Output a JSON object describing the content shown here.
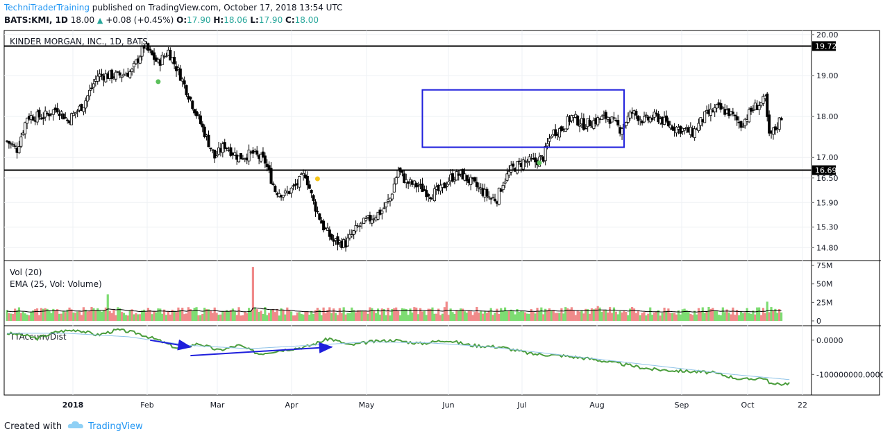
{
  "header": {
    "author": "TechniTraderTraining",
    "published": "published on TradingView.com, October 17, 2018 13:54 UTC",
    "symbol": "BATS:KMI, 1D",
    "last": "18.00",
    "change": "+0.08 (+0.45%)",
    "o_label": "O:",
    "o_value": "17.90",
    "h_label": "H:",
    "h_value": "18.06",
    "l_label": "L:",
    "l_value": "17.90",
    "c_label": "C:",
    "c_value": "18.00"
  },
  "footer": {
    "created_with": "Created with",
    "brand": "TradingView"
  },
  "colors": {
    "up": "#26c749",
    "down": "#000000",
    "vol_up": "#7ddc72",
    "vol_down": "#f08a8a",
    "box": "#1f1fdc",
    "arrow": "#1f1fdc",
    "osc": "#4a9d3c",
    "osc_ma": "#8fc3e8",
    "dot_green": "#5cc05c",
    "dot_yellow": "#f5c518"
  },
  "chart_data": [
    {
      "type": "candlestick",
      "title": "KINDER MORGAN, INC., 1D, BATS",
      "y_ticks": [
        20.0,
        19.0,
        18.0,
        17.0,
        16.5,
        15.9,
        15.3,
        14.8
      ],
      "y_tick_labels": [
        "20.00",
        "19.00",
        "18.00",
        "17.00",
        "16.50",
        "15.90",
        "15.30",
        "14.80"
      ],
      "ylim": [
        14.5,
        20.1
      ],
      "x_tick_labels": [
        "2018",
        "Feb",
        "Mar",
        "Apr",
        "May",
        "Jun",
        "Jul",
        "Aug",
        "Sep",
        "Oct",
        "22"
      ],
      "horizontal_lines": [
        {
          "price": 19.72,
          "label": "19.72"
        },
        {
          "price": 16.69,
          "label": "16.69"
        }
      ],
      "range_box": {
        "start_day": 206,
        "end_day": 306,
        "top": 18.65,
        "bottom": 17.25
      },
      "close_path": [
        [
          0,
          17.4
        ],
        [
          5,
          17.2
        ],
        [
          10,
          18.0
        ],
        [
          18,
          18.0
        ],
        [
          25,
          18.2
        ],
        [
          30,
          17.9
        ],
        [
          38,
          18.3
        ],
        [
          45,
          19.0
        ],
        [
          55,
          19.0
        ],
        [
          62,
          19.1
        ],
        [
          68,
          19.72
        ],
        [
          75,
          19.3
        ],
        [
          80,
          19.6
        ],
        [
          86,
          19.0
        ],
        [
          92,
          18.3
        ],
        [
          98,
          17.6
        ],
        [
          103,
          17.0
        ],
        [
          108,
          17.3
        ],
        [
          115,
          17.0
        ],
        [
          122,
          17.1
        ],
        [
          128,
          16.9
        ],
        [
          133,
          16.2
        ],
        [
          138,
          16.1
        ],
        [
          143,
          16.3
        ],
        [
          148,
          16.6
        ],
        [
          152,
          15.9
        ],
        [
          157,
          15.3
        ],
        [
          162,
          14.95
        ],
        [
          168,
          14.9
        ],
        [
          174,
          15.3
        ],
        [
          180,
          15.5
        ],
        [
          186,
          15.7
        ],
        [
          190,
          16.0
        ],
        [
          194,
          16.7
        ],
        [
          198,
          16.4
        ],
        [
          204,
          16.3
        ],
        [
          210,
          16.1
        ],
        [
          215,
          16.2
        ],
        [
          220,
          16.5
        ],
        [
          225,
          16.6
        ],
        [
          230,
          16.4
        ],
        [
          235,
          16.2
        ],
        [
          240,
          16.0
        ],
        [
          243,
          16.0
        ],
        [
          246,
          16.4
        ],
        [
          250,
          16.7
        ],
        [
          256,
          16.9
        ],
        [
          262,
          16.9
        ],
        [
          266,
          17.0
        ],
        [
          270,
          17.6
        ],
        [
          275,
          17.7
        ],
        [
          280,
          18.0
        ],
        [
          286,
          17.8
        ],
        [
          292,
          17.9
        ],
        [
          298,
          18.0
        ],
        [
          304,
          17.7
        ],
        [
          310,
          18.1
        ],
        [
          316,
          17.9
        ],
        [
          322,
          18.0
        ],
        [
          328,
          17.8
        ],
        [
          334,
          17.7
        ],
        [
          340,
          17.6
        ],
        [
          346,
          18.0
        ],
        [
          352,
          18.2
        ],
        [
          358,
          18.1
        ],
        [
          364,
          17.8
        ],
        [
          370,
          18.2
        ],
        [
          376,
          18.4
        ],
        [
          378,
          17.5
        ],
        [
          381,
          17.7
        ],
        [
          384,
          18.0
        ]
      ],
      "dots": [
        {
          "day": 75,
          "price": 18.85,
          "color": "green"
        },
        {
          "day": 154,
          "price": 16.48,
          "color": "yellow"
        },
        {
          "day": 264,
          "price": 16.87,
          "color": "green"
        }
      ]
    },
    {
      "type": "bar",
      "title": "Vol (20)",
      "subtitle": "EMA (25, Vol: Volume)",
      "y_ticks": [
        75,
        50,
        25,
        0
      ],
      "y_tick_labels": [
        "75M",
        "50M",
        "25M",
        "0"
      ],
      "unit": "M",
      "ylim": [
        0,
        75
      ],
      "typical_volume": 13,
      "spikes": [
        {
          "day": 50,
          "value": 36
        },
        {
          "day": 122,
          "value": 73
        },
        {
          "day": 218,
          "value": 26
        },
        {
          "day": 293,
          "value": 20
        },
        {
          "day": 377,
          "value": 26
        }
      ]
    },
    {
      "type": "line",
      "title": "TTAccum/Dist",
      "y_ticks": [
        0,
        -100000000
      ],
      "y_tick_labels": [
        "0.0000",
        "-100000000.0000"
      ],
      "ylim": [
        -160000000,
        40000000
      ],
      "series": [
        {
          "name": "TTAccum/Dist",
          "points": [
            [
              0,
              20000000
            ],
            [
              8,
              15000000
            ],
            [
              15,
              5000000
            ],
            [
              25,
              25000000
            ],
            [
              35,
              30000000
            ],
            [
              45,
              15000000
            ],
            [
              55,
              30000000
            ],
            [
              65,
              20000000
            ],
            [
              75,
              0
            ],
            [
              85,
              -25000000
            ],
            [
              95,
              -10000000
            ],
            [
              105,
              -30000000
            ],
            [
              115,
              -15000000
            ],
            [
              125,
              -40000000
            ],
            [
              135,
              -30000000
            ],
            [
              148,
              -20000000
            ],
            [
              160,
              5000000
            ],
            [
              170,
              -15000000
            ],
            [
              180,
              -5000000
            ],
            [
              192,
              0
            ],
            [
              205,
              -10000000
            ],
            [
              218,
              0
            ],
            [
              230,
              -15000000
            ],
            [
              245,
              -20000000
            ],
            [
              260,
              -40000000
            ],
            [
              275,
              -45000000
            ],
            [
              290,
              -55000000
            ],
            [
              305,
              -70000000
            ],
            [
              320,
              -85000000
            ],
            [
              335,
              -90000000
            ],
            [
              350,
              -95000000
            ],
            [
              365,
              -115000000
            ],
            [
              375,
              -110000000
            ],
            [
              380,
              -130000000
            ],
            [
              388,
              -125000000
            ]
          ]
        },
        {
          "name": "MA",
          "points": [
            [
              0,
              20000000
            ],
            [
              30,
              20000000
            ],
            [
              60,
              10000000
            ],
            [
              90,
              -15000000
            ],
            [
              120,
              -25000000
            ],
            [
              150,
              -15000000
            ],
            [
              180,
              -5000000
            ],
            [
              210,
              -8000000
            ],
            [
              240,
              -20000000
            ],
            [
              270,
              -40000000
            ],
            [
              300,
              -60000000
            ],
            [
              330,
              -80000000
            ],
            [
              360,
              -100000000
            ],
            [
              388,
              -115000000
            ]
          ]
        }
      ]
    }
  ],
  "annotations": {
    "arrows": [
      {
        "from": [
          71,
          0
        ],
        "to": [
          91,
          -20000000
        ]
      },
      {
        "from": [
          91,
          -45000000
        ],
        "to": [
          161,
          -20000000
        ]
      }
    ]
  }
}
